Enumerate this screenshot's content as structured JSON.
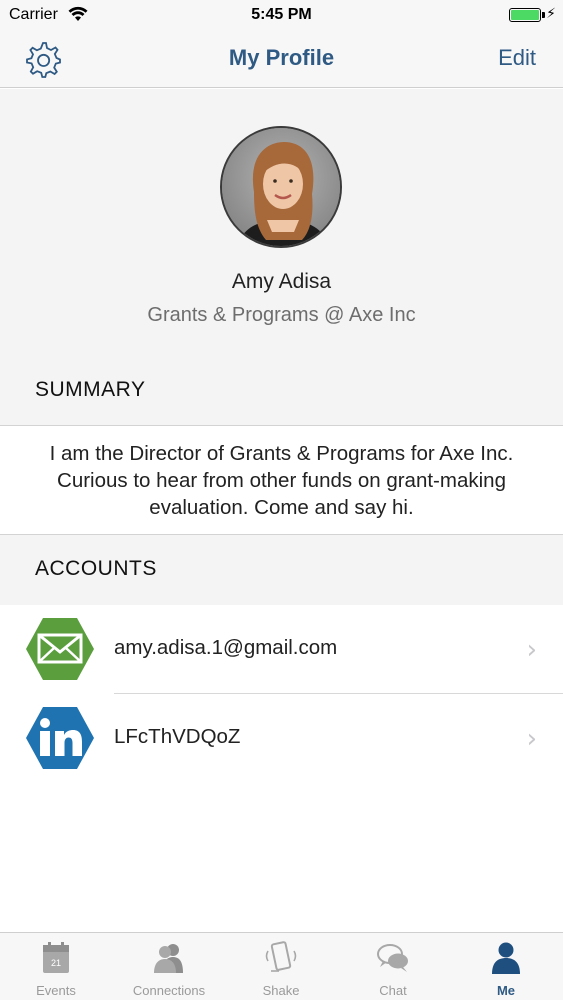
{
  "status_bar": {
    "carrier": "Carrier",
    "time": "5:45 PM",
    "battery_level": 1.0
  },
  "nav": {
    "title": "My Profile",
    "edit_label": "Edit",
    "settings_icon": "gear-icon"
  },
  "profile": {
    "name": "Amy Adisa",
    "headline": "Grants & Programs @ Axe Inc"
  },
  "summary": {
    "header": "SUMMARY",
    "text": "I am the Director of Grants & Programs for Axe Inc. Curious to hear from other funds on grant-making evaluation. Come and say hi."
  },
  "accounts": {
    "header": "ACCOUNTS",
    "items": [
      {
        "icon": "email-icon",
        "label": "amy.adisa.1@gmail.com",
        "color": "#5a9e3e"
      },
      {
        "icon": "linkedin-icon",
        "label": "LFcThVDQoZ",
        "color": "#1f73b1"
      }
    ]
  },
  "tab_bar": {
    "tabs": [
      {
        "label": "Events",
        "icon": "calendar-icon",
        "calendar_day": "21",
        "active": false
      },
      {
        "label": "Connections",
        "icon": "people-icon",
        "active": false
      },
      {
        "label": "Shake",
        "icon": "phone-shake-icon",
        "active": false
      },
      {
        "label": "Chat",
        "icon": "chat-bubbles-icon",
        "active": false
      },
      {
        "label": "Me",
        "icon": "person-icon",
        "active": true
      }
    ]
  },
  "colors": {
    "accent": "#2f5a84",
    "email_green": "#5a9e3e",
    "linkedin_blue": "#1f73b1"
  }
}
